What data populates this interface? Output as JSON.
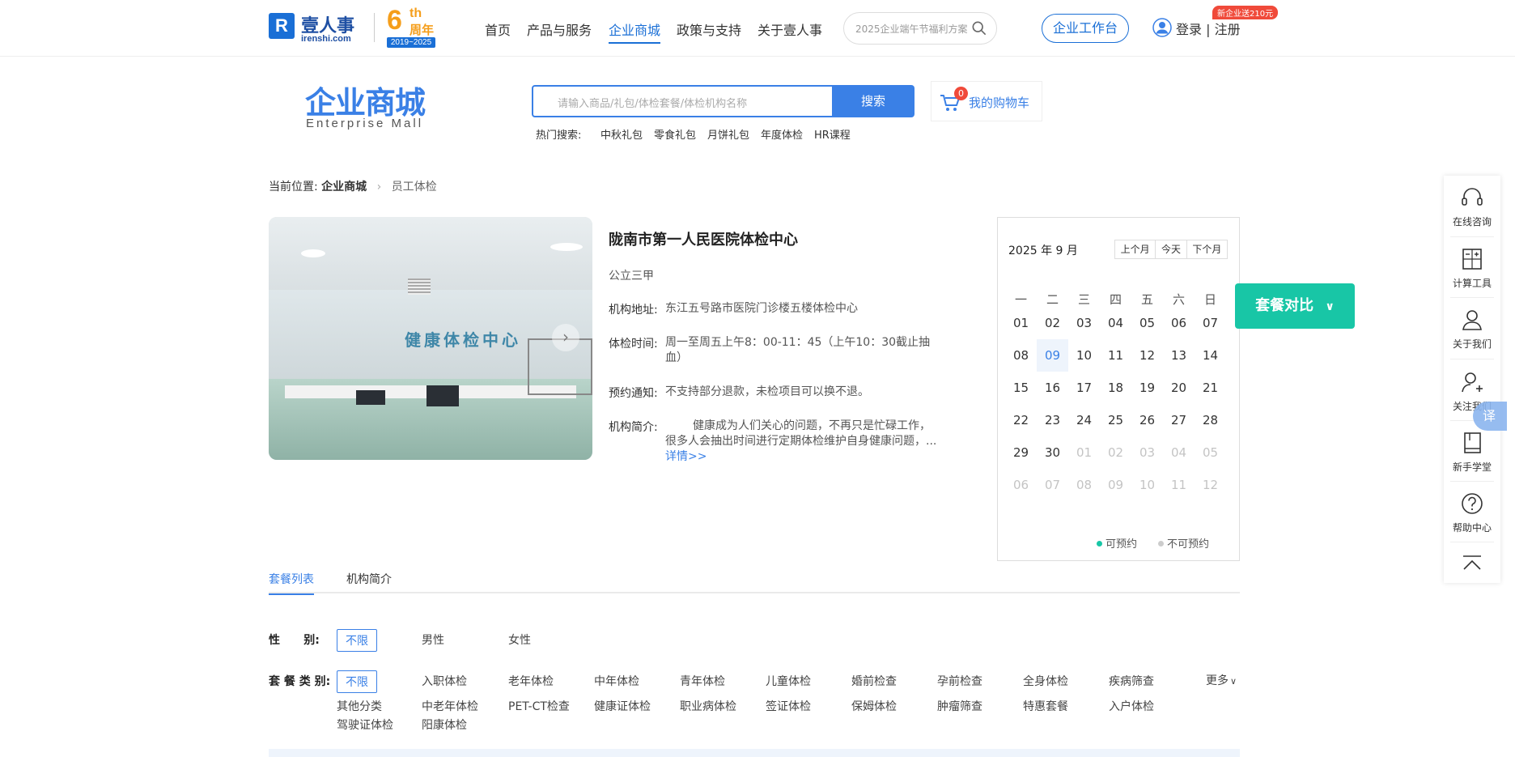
{
  "topbar": {
    "logo_cn": "壹人事",
    "logo_en": "irenshi.com",
    "anniv_number": "6",
    "anniv_th": "th",
    "anniv_cn": "周年",
    "anniv_years": "2019~2025",
    "nav": [
      "首页",
      "产品与服务",
      "企业商城",
      "政策与支持",
      "关于壹人事"
    ],
    "search_placeholder": "2025企业端午节福利方案",
    "workbench": "企业工作台",
    "login": "登录 | 注册",
    "promo": "新企业送210元"
  },
  "mall": {
    "title_cn": "企业商城",
    "title_en": "Enterprise Mall",
    "search_placeholder": "请输入商品/礼包/体检套餐/体检机构名称",
    "search_button": "搜索",
    "cart_count": "0",
    "cart_label": "我的购物车",
    "hot_label": "热门搜索:",
    "hot": [
      "中秋礼包",
      "零食礼包",
      "月饼礼包",
      "年度体检",
      "HR课程"
    ]
  },
  "breadcrumb": {
    "prefix": "当前位置:",
    "level1": "企业商城",
    "current": "员工体检"
  },
  "hero": {
    "sign_text": "健康体检中心"
  },
  "institution": {
    "name": "陇南市第一人民医院体检中心",
    "grade": "公立三甲",
    "address_label": "机构地址:",
    "address": "东江五号路市医院门诊楼五楼体检中心",
    "hours_label": "体检时间:",
    "hours": "周一至周五上午8：00-11：45（上午10：30截止抽血）",
    "notice_label": "预约通知:",
    "notice": "不支持部分退款，未检项目可以换不退。",
    "intro_label": "机构简介:",
    "intro": "健康成为人们关心的问题，不再只是忙碌工作，很多人会抽出时间进行定期体检维护自身健康问题，...",
    "detail_link": "详情>>"
  },
  "calendar": {
    "month": "2025 年 9 月",
    "prev": "上个月",
    "today": "今天",
    "next": "下个月",
    "weekdays": [
      "一",
      "二",
      "三",
      "四",
      "五",
      "六",
      "日"
    ],
    "weeks": [
      [
        "01",
        "02",
        "03",
        "04",
        "05",
        "06",
        "07"
      ],
      [
        "08",
        "09",
        "10",
        "11",
        "12",
        "13",
        "14"
      ],
      [
        "15",
        "16",
        "17",
        "18",
        "19",
        "20",
        "21"
      ],
      [
        "22",
        "23",
        "24",
        "25",
        "26",
        "27",
        "28"
      ],
      [
        "29",
        "30",
        "01",
        "02",
        "03",
        "04",
        "05"
      ],
      [
        "06",
        "07",
        "08",
        "09",
        "10",
        "11",
        "12"
      ]
    ],
    "today_value": "09",
    "legend_available": "可预约",
    "legend_unavailable": "不可预约",
    "available_color": "#18c6a6",
    "unavailable_color": "#cccccc"
  },
  "compare_button": "套餐对比",
  "sidebar": [
    "在线咨询",
    "计算工具",
    "关于我们",
    "关注我们",
    "新手学堂",
    "帮助中心"
  ],
  "translate_label": "译",
  "tabs": [
    "套餐列表",
    "机构简介"
  ],
  "filters": {
    "gender_label": "性      别:",
    "gender_options": [
      "不限",
      "男性",
      "女性"
    ],
    "type_label": "套 餐 类 别:",
    "type_row1": [
      "不限",
      "入职体检",
      "老年体检",
      "中年体检",
      "青年体检",
      "儿童体检",
      "婚前检查",
      "孕前检查",
      "全身体检",
      "疾病筛查"
    ],
    "type_row2": [
      "其他分类",
      "中老年体检",
      "PET-CT检查",
      "健康证体检",
      "职业病体检",
      "签证体检",
      "保姆体检",
      "肿瘤筛查",
      "特惠套餐",
      "入户体检"
    ],
    "type_row3": [
      "驾驶证体检",
      "阳康体检"
    ],
    "more": "更多"
  },
  "colors": {
    "accent": "#3a80e6",
    "brand": "#1a6fd6",
    "compare": "#18c6a6",
    "badge": "#f04a3a"
  }
}
